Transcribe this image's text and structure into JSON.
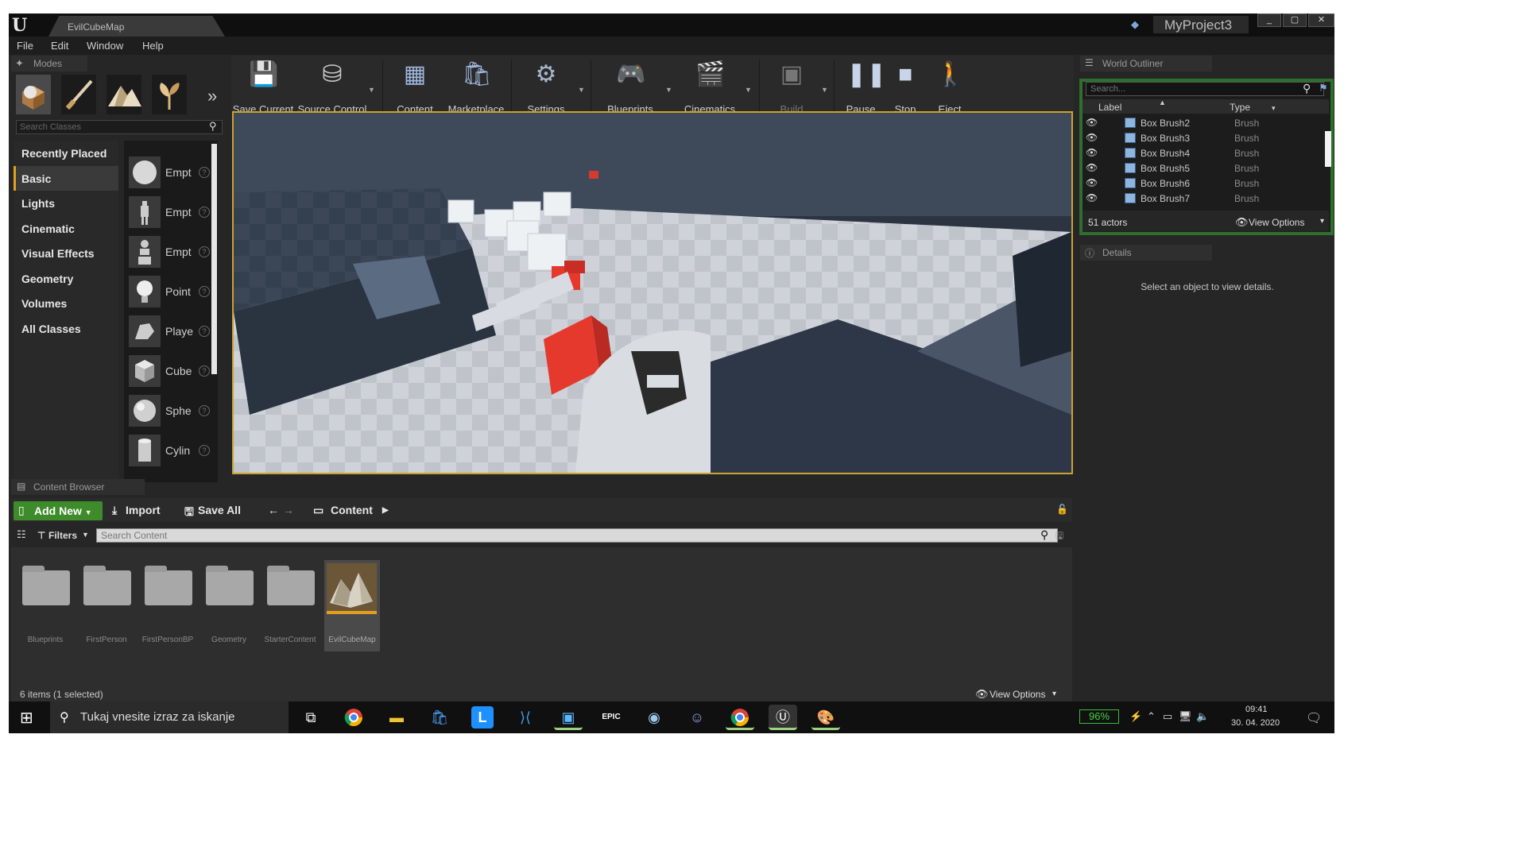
{
  "window": {
    "tab_title": "EvilCubeMap",
    "project_name": "MyProject3",
    "controls": [
      "_",
      "▢",
      "✕"
    ]
  },
  "menu": [
    "File",
    "Edit",
    "Window",
    "Help"
  ],
  "modes": {
    "tab_label": "Modes",
    "mode_icons": [
      "place-mode-icon",
      "paint-mode-icon",
      "landscape-mode-icon",
      "foliage-mode-icon"
    ],
    "search_placeholder": "Search Classes",
    "categories": [
      "Recently Placed",
      "Basic",
      "Lights",
      "Cinematic",
      "Visual Effects",
      "Geometry",
      "Volumes",
      "All Classes"
    ],
    "active_category": "Basic",
    "items": [
      "Empt",
      "Empt",
      "Empt",
      "Point",
      "Playe",
      "Cube",
      "Sphe",
      "Cylin"
    ]
  },
  "toolbar": {
    "save_current": "Save Current",
    "source_control": "Source Control",
    "content": "Content",
    "marketplace": "Marketplace",
    "settings": "Settings",
    "blueprints": "Blueprints",
    "cinematics": "Cinematics",
    "build": "Build",
    "pause": "Pause",
    "stop": "Stop",
    "eject": "Eject"
  },
  "outliner": {
    "tab_label": "World Outliner",
    "search_placeholder": "Search...",
    "col_label": "Label",
    "col_type": "Type",
    "rows": [
      {
        "label": "Box Brush2",
        "type": "Brush"
      },
      {
        "label": "Box Brush3",
        "type": "Brush"
      },
      {
        "label": "Box Brush4",
        "type": "Brush"
      },
      {
        "label": "Box Brush5",
        "type": "Brush"
      },
      {
        "label": "Box Brush6",
        "type": "Brush"
      },
      {
        "label": "Box Brush7",
        "type": "Brush"
      }
    ],
    "actor_count": "51 actors",
    "view_options": "View Options"
  },
  "details": {
    "tab_label": "Details",
    "message": "Select an object to view details."
  },
  "content_browser": {
    "tab_label": "Content Browser",
    "add_new": "Add New",
    "import": "Import",
    "save_all": "Save All",
    "path": "Content",
    "filters": "Filters",
    "search_placeholder": "Search Content",
    "assets": [
      "Blueprints",
      "FirstPerson",
      "FirstPersonBP",
      "Geometry",
      "StarterContent",
      "EvilCubeMap"
    ],
    "selected_asset": "EvilCubeMap",
    "status": "6 items (1 selected)",
    "view_options": "View Options"
  },
  "taskbar": {
    "search_placeholder": "Tukaj vnesite izraz za iskanje",
    "battery": "96%",
    "time": "09:41",
    "date": "30. 04. 2020"
  },
  "colors": {
    "accent_orange": "#e3a020",
    "add_new_green": "#3d8b2a",
    "outliner_border": "#2e6e2e",
    "selected_red": "#e6392e"
  }
}
